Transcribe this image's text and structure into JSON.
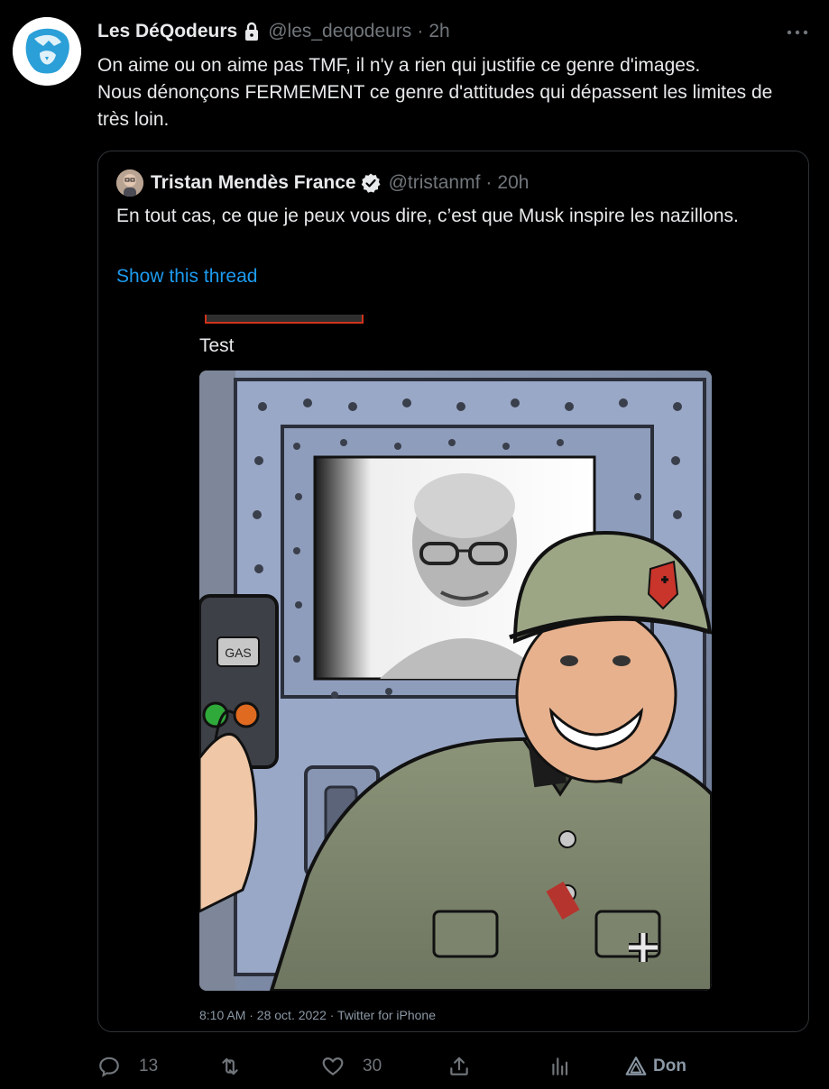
{
  "tweet": {
    "display_name": "Les DéQodeurs",
    "handle": "@les_deqodeurs",
    "separator": "·",
    "time": "2h",
    "text": "On aime ou on aime pas TMF, il n'y a rien qui justifie ce genre d'images.\nNous dénonçons FERMEMENT ce genre d'attitudes qui dépassent les limites de très loin."
  },
  "quoted": {
    "display_name": "Tristan Mendès France",
    "handle": "@tristanmf",
    "separator": "·",
    "time": "20h",
    "text": "En tout cas, ce que je peux vous dire, c’est que Musk inspire les nazillons.",
    "thread_link": "Show this thread",
    "inner_caption": "Test",
    "meme_label": "GAS",
    "image_timestamp": "8:10 AM · 28 oct. 2022 · Twitter for iPhone"
  },
  "actions": {
    "replies": "13",
    "retweets": "",
    "likes": "30",
    "donate_label": "Don"
  },
  "colors": {
    "background": "#000000",
    "text": "#e7e9ea",
    "muted": "#71767b",
    "link": "#1d9bf0",
    "border": "#2f3336",
    "avatar_brand": "#1d9bf0"
  }
}
